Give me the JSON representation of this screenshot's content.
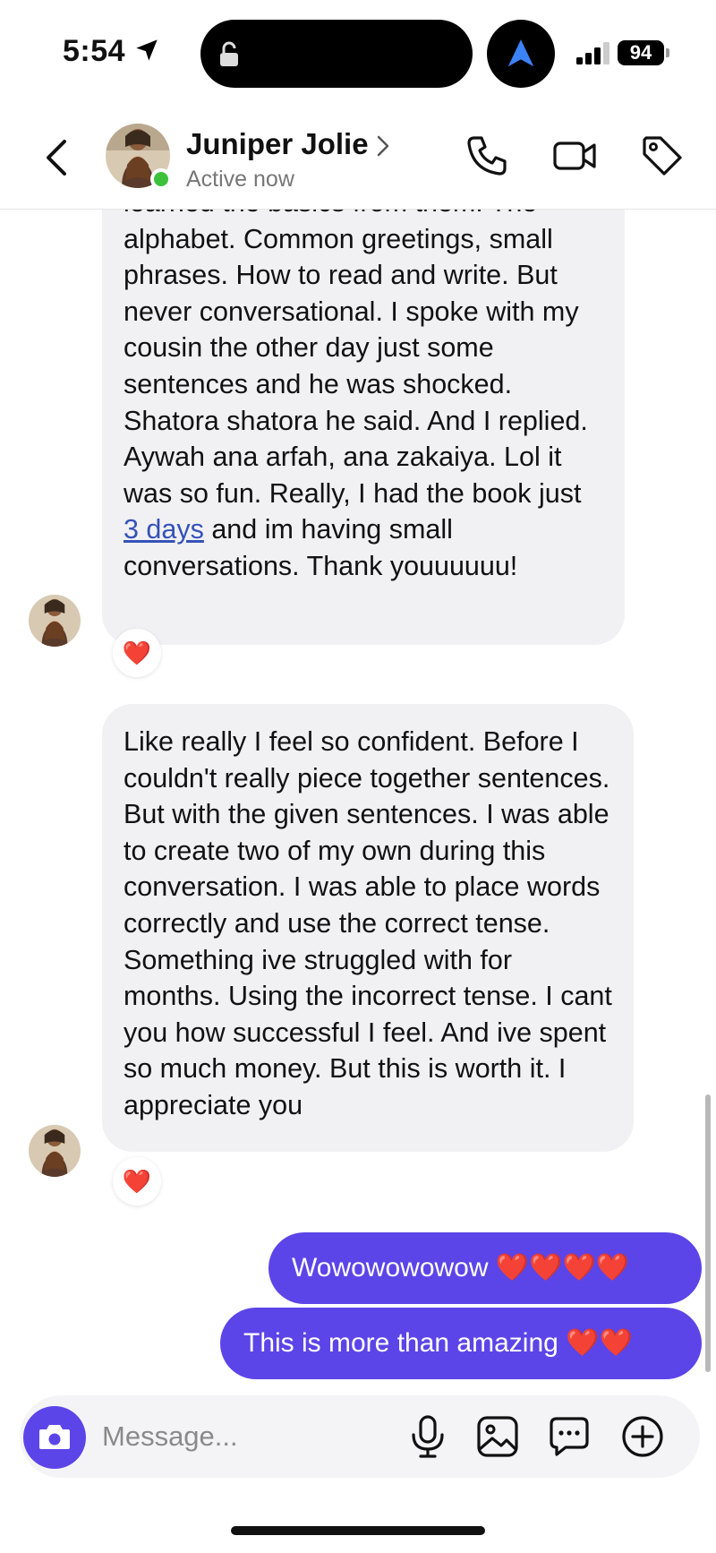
{
  "status_bar": {
    "time": "5:54",
    "battery": "94",
    "icons": [
      "location-arrow-icon",
      "lock-icon",
      "navigation-icon",
      "signal-icon",
      "battery-icon"
    ]
  },
  "header": {
    "contact_name": "Juniper Jolie",
    "status": "Active now",
    "icons": [
      "back-icon",
      "chevron-right-icon",
      "phone-icon",
      "video-icon",
      "tag-icon"
    ]
  },
  "messages": [
    {
      "direction": "incoming",
      "text_before_link": "learned the basics from them. The alphabet. Common greetings, small phrases. How to read and write. But never conversational. I spoke with my cousin the other day just some sentences and he was shocked. Shatora shatora he said. And I replied. Aywah ana arfah, ana zakaiya. Lol it was so fun. Really, I had the book just ",
      "link_text": "3 days",
      "text_after_link": " and im having small conversations. Thank youuuuuu!",
      "reaction": "❤️"
    },
    {
      "direction": "incoming",
      "text": "Like really I feel so confident. Before I couldn't really piece together sentences. But with the given sentences. I was able to create two of my own during this conversation. I was able to place words correctly and use the correct tense. Something ive struggled with for months. Using the incorrect tense. I cant you how successful I feel. And ive spent so much money. But this is worth it. I appreciate you",
      "reaction": "❤️"
    },
    {
      "direction": "outgoing",
      "text": "Wowowowowow ❤️❤️❤️❤️"
    },
    {
      "direction": "outgoing",
      "text": "This is more than amazing ❤️❤️"
    }
  ],
  "composer": {
    "placeholder": "Message...",
    "icons": [
      "camera-icon",
      "microphone-icon",
      "image-icon",
      "chat-bubble-icon",
      "plus-icon"
    ]
  },
  "colors": {
    "accent": "#5b45e8",
    "incoming_bubble": "#f1f1f4",
    "online": "#3cc13b",
    "link": "#3552b8"
  }
}
